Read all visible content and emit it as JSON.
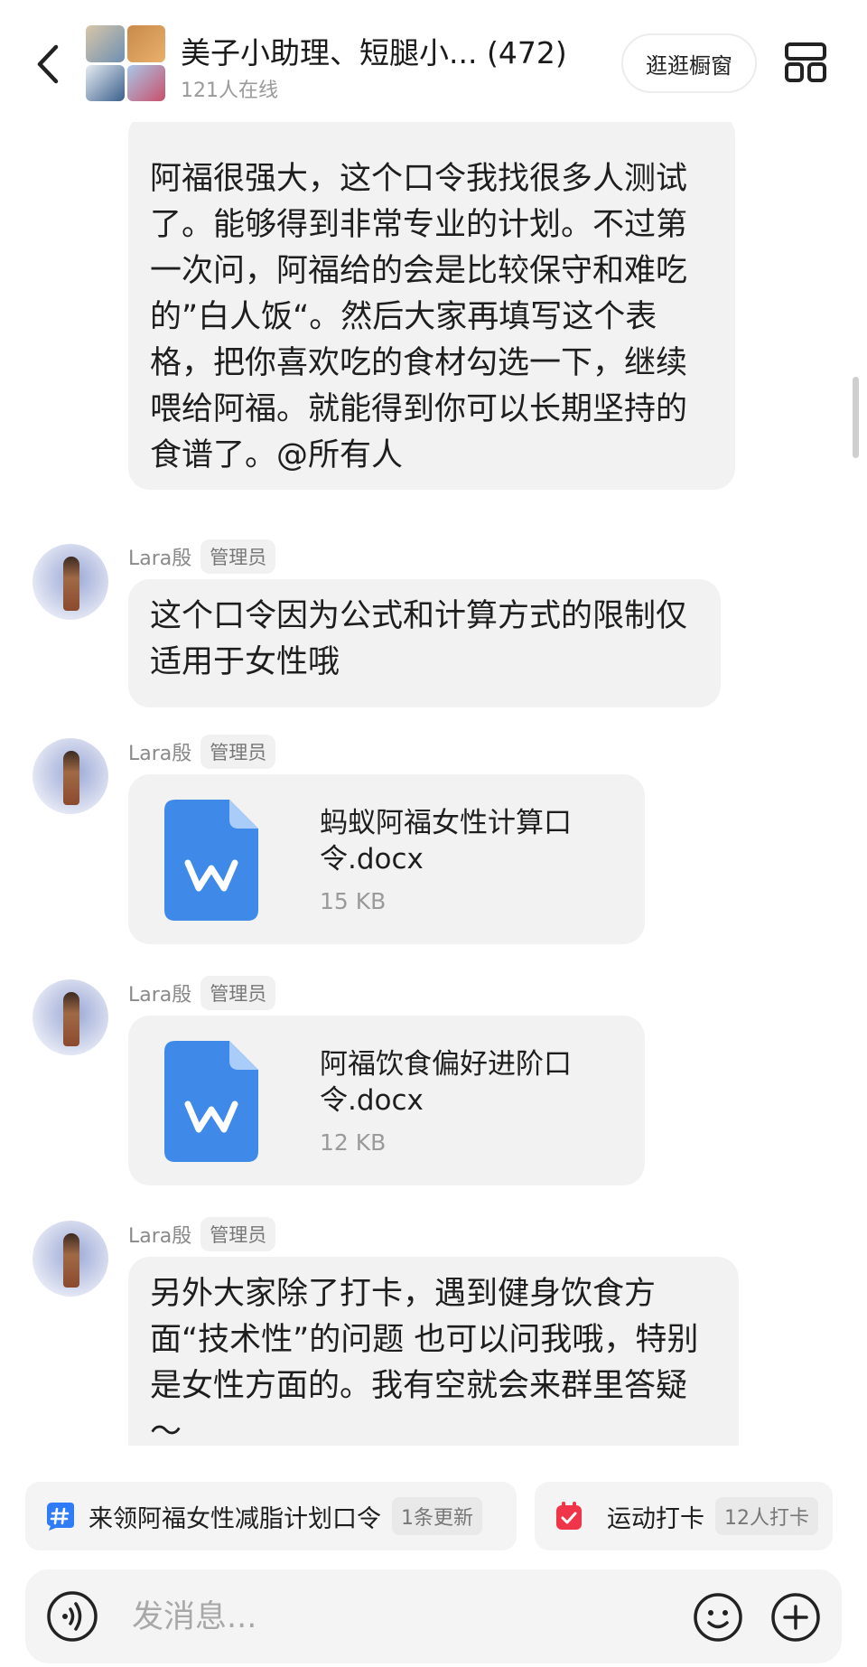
{
  "header": {
    "title": "美子小助理、短腿小... (472)",
    "online": "121人在线",
    "showcase_button": "逛逛橱窗",
    "icons": [
      "back-icon",
      "layout-icon"
    ]
  },
  "messages": [
    {
      "type": "text",
      "text": "阿福很强大，这个口令我找很多人测试了。能够得到非常专业的计划。不过第一次问，阿福给的会是比较保守和难吃的”白人饭“。然后大家再填写这个表格，把你喜欢吃的食材勾选一下，继续喂给阿福。就能得到你可以长期坚持的食谱了。@所有人"
    },
    {
      "type": "text",
      "sender": "Lara殷",
      "badge": "管理员",
      "text": "这个口令因为公式和计算方式的限制仅适用于女性哦"
    },
    {
      "type": "file",
      "sender": "Lara殷",
      "badge": "管理员",
      "file_name": "蚂蚁阿福女性计算口令.docx",
      "file_size": "15 KB"
    },
    {
      "type": "file",
      "sender": "Lara殷",
      "badge": "管理员",
      "file_name": "阿福饮食偏好进阶口令.docx",
      "file_size": "12 KB"
    },
    {
      "type": "text",
      "sender": "Lara殷",
      "badge": "管理员",
      "text": "另外大家除了打卡，遇到健身饮食方面“技术性”的问题 也可以问我哦，特别是女性方面的。我有空就会来群里答疑～"
    }
  ],
  "chips": [
    {
      "label": "来领阿福女性减脂计划口令",
      "tag": "1条更新",
      "icon": "hashtag-icon",
      "color": "#2f7cf6"
    },
    {
      "label": "运动打卡",
      "tag": "12人打卡",
      "icon": "calendar-check-icon",
      "color": "#f0344a"
    }
  ],
  "input": {
    "placeholder": "发消息..."
  },
  "colors": {
    "file_icon": "#3f8ae8",
    "bubble": "#f2f2f2"
  }
}
